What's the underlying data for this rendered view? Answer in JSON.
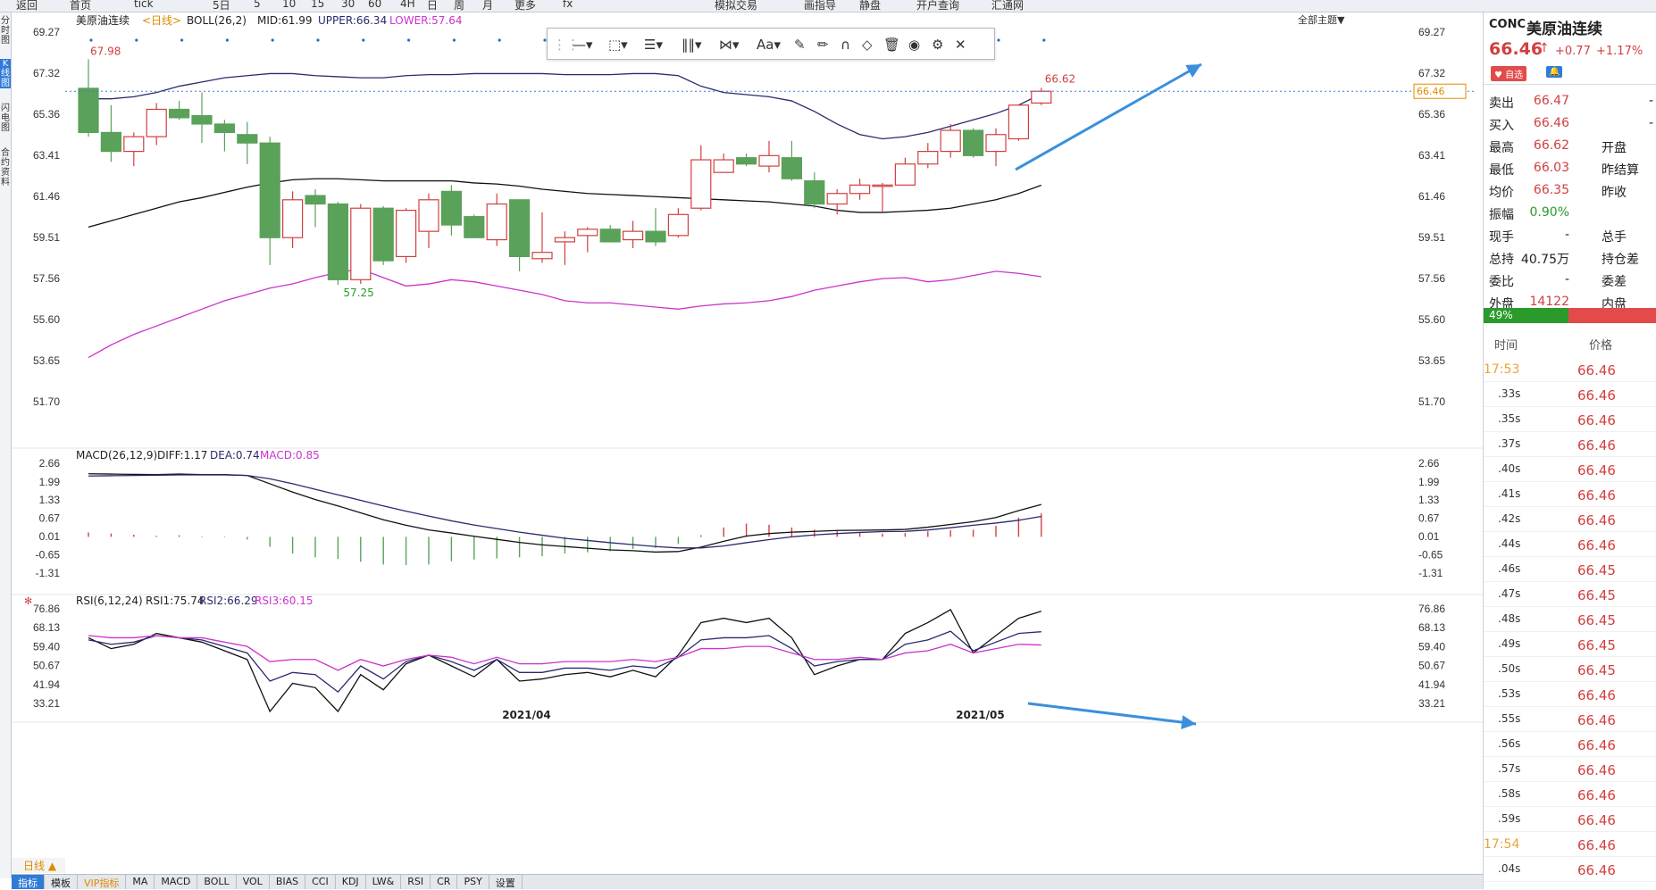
{
  "toolbar": {
    "items": [
      "返回",
      "首页",
      "tick",
      "5日",
      "5",
      "10",
      "15",
      "30",
      "60",
      "4H",
      "日",
      "周",
      "月",
      "更多",
      "fx",
      "模拟交易",
      "画指导",
      "静盘",
      "开户查询",
      "汇通网"
    ]
  },
  "left_tabs": [
    "分时图",
    "K线图",
    "闪电图",
    "合约资料"
  ],
  "chart": {
    "symbol": "美原油连续",
    "period": "<日线>",
    "boll": {
      "label": "BOLL(26,2)",
      "mid": "MID:61.99",
      "upper": "UPPER:66.34",
      "lower": "LOWER:57.64"
    },
    "main_axis": [
      "69.27",
      "67.32",
      "65.36",
      "63.41",
      "61.46",
      "59.51",
      "57.56",
      "55.60",
      "53.65",
      "51.70"
    ],
    "high_label": "67.98",
    "low_label": "57.25",
    "last_high_label": "66.62",
    "price_tag": "66.46",
    "main_theme": "全部主题▼",
    "macd": {
      "label": "MACD(26,12,9)",
      "diff": "DIFF:1.17",
      "dea": "DEA:0.74",
      "macd": "MACD:0.85",
      "axis": [
        "2.66",
        "1.99",
        "1.33",
        "0.67",
        "0.01",
        "-0.65",
        "-1.31"
      ]
    },
    "rsi": {
      "label": "RSI(6,12,24)",
      "rsi1": "RSI1:75.74",
      "rsi2": "RSI2:66.29",
      "rsi3": "RSI3:60.15",
      "axis": [
        "76.86",
        "68.13",
        "59.40",
        "50.67",
        "41.94",
        "33.21"
      ]
    },
    "x_labels": [
      "2021/04",
      "2021/05"
    ],
    "colors": {
      "up": "#d23f3f",
      "down": "#5aa15a",
      "upper": "#2a2a6e",
      "mid": "#111111",
      "lower": "#cc33cc",
      "arrow": "#3c8fdc"
    }
  },
  "chart_data": [
    {
      "type": "candlestick",
      "title": "美原油连续 日线 BOLL(26,2)",
      "ylim": [
        51.7,
        69.27
      ],
      "ohlc": [
        [
          66.6,
          67.98,
          64.3,
          64.5
        ],
        [
          64.5,
          65.8,
          63.1,
          63.6
        ],
        [
          63.6,
          64.5,
          62.9,
          64.3
        ],
        [
          64.3,
          65.9,
          63.9,
          65.6
        ],
        [
          65.6,
          66.0,
          65.1,
          65.2
        ],
        [
          65.3,
          66.4,
          64.0,
          64.9
        ],
        [
          64.9,
          65.1,
          63.6,
          64.5
        ],
        [
          64.4,
          65.0,
          63.0,
          64.0
        ],
        [
          64.0,
          64.3,
          58.2,
          59.5
        ],
        [
          59.5,
          61.7,
          59.0,
          61.3
        ],
        [
          61.5,
          61.8,
          60.0,
          61.1
        ],
        [
          61.1,
          61.2,
          57.25,
          57.5
        ],
        [
          57.5,
          61.1,
          57.3,
          60.9
        ],
        [
          60.9,
          61.0,
          58.2,
          58.4
        ],
        [
          58.6,
          60.9,
          58.3,
          60.8
        ],
        [
          59.8,
          61.6,
          59.0,
          61.3
        ],
        [
          61.7,
          62.0,
          59.6,
          60.1
        ],
        [
          60.5,
          60.6,
          59.5,
          59.5
        ],
        [
          59.4,
          61.6,
          59.1,
          61.1
        ],
        [
          61.3,
          61.3,
          57.9,
          58.6
        ],
        [
          58.5,
          60.7,
          58.3,
          58.8
        ],
        [
          59.3,
          59.8,
          58.2,
          59.5
        ],
        [
          59.6,
          60.0,
          58.8,
          59.9
        ],
        [
          59.9,
          60.1,
          59.3,
          59.3
        ],
        [
          59.4,
          60.3,
          59.0,
          59.8
        ],
        [
          59.8,
          60.9,
          59.1,
          59.3
        ],
        [
          59.6,
          60.9,
          59.5,
          60.6
        ],
        [
          60.9,
          63.9,
          60.8,
          63.2
        ],
        [
          62.6,
          63.5,
          62.6,
          63.2
        ],
        [
          63.3,
          63.5,
          62.9,
          63.0
        ],
        [
          62.9,
          64.1,
          62.6,
          63.4
        ],
        [
          63.3,
          64.1,
          62.2,
          62.3
        ],
        [
          62.2,
          62.6,
          60.9,
          61.1
        ],
        [
          61.1,
          61.8,
          60.6,
          61.6
        ],
        [
          61.6,
          62.3,
          61.3,
          62.0
        ],
        [
          62.0,
          62.1,
          60.7,
          62.0
        ],
        [
          62.0,
          63.3,
          62.0,
          63.0
        ],
        [
          63.0,
          64.0,
          62.8,
          63.6
        ],
        [
          63.6,
          64.9,
          63.3,
          64.6
        ],
        [
          64.6,
          64.7,
          63.3,
          63.4
        ],
        [
          63.6,
          64.7,
          62.9,
          64.4
        ],
        [
          64.2,
          65.4,
          64.1,
          65.8
        ],
        [
          65.9,
          66.62,
          65.8,
          66.46
        ]
      ],
      "boll_upper": [
        66.1,
        66.1,
        66.2,
        66.4,
        66.7,
        66.9,
        67.1,
        67.2,
        67.3,
        67.3,
        67.2,
        67.15,
        67.1,
        67.1,
        67.2,
        67.25,
        67.25,
        67.3,
        67.3,
        67.3,
        67.3,
        67.25,
        67.25,
        67.25,
        67.3,
        67.3,
        67.2,
        66.7,
        66.4,
        66.3,
        66.2,
        66.0,
        65.5,
        64.9,
        64.4,
        64.2,
        64.3,
        64.5,
        64.8,
        65.1,
        65.4,
        65.8,
        66.34
      ],
      "boll_mid": [
        60.0,
        60.3,
        60.6,
        60.9,
        61.2,
        61.4,
        61.65,
        61.9,
        62.1,
        62.25,
        62.3,
        62.3,
        62.25,
        62.2,
        62.2,
        62.2,
        62.2,
        62.1,
        62.05,
        61.95,
        61.8,
        61.7,
        61.6,
        61.55,
        61.5,
        61.45,
        61.4,
        61.35,
        61.3,
        61.25,
        61.2,
        61.1,
        61.0,
        60.8,
        60.7,
        60.7,
        60.75,
        60.8,
        60.9,
        61.1,
        61.3,
        61.6,
        61.99
      ],
      "boll_lower": [
        53.8,
        54.4,
        54.9,
        55.3,
        55.7,
        56.1,
        56.5,
        56.8,
        57.1,
        57.3,
        57.6,
        57.85,
        58.0,
        57.6,
        57.2,
        57.3,
        57.5,
        57.4,
        57.2,
        57.0,
        56.8,
        56.5,
        56.4,
        56.4,
        56.3,
        56.2,
        56.1,
        56.25,
        56.35,
        56.4,
        56.5,
        56.7,
        57.0,
        57.2,
        57.4,
        57.55,
        57.6,
        57.4,
        57.5,
        57.7,
        57.9,
        57.8,
        57.64
      ]
    },
    {
      "type": "line",
      "title": "MACD(26,12,9)",
      "ylim": [
        -1.31,
        2.66
      ],
      "diff": [
        2.28,
        2.27,
        2.26,
        2.25,
        2.27,
        2.25,
        2.25,
        2.22,
        1.92,
        1.62,
        1.35,
        1.12,
        0.87,
        0.62,
        0.42,
        0.25,
        0.14,
        0.02,
        -0.09,
        -0.2,
        -0.29,
        -0.35,
        -0.41,
        -0.47,
        -0.5,
        -0.55,
        -0.53,
        -0.37,
        -0.16,
        0.03,
        0.12,
        0.17,
        0.2,
        0.23,
        0.24,
        0.25,
        0.27,
        0.35,
        0.45,
        0.55,
        0.7,
        0.95,
        1.17
      ],
      "dea": [
        2.2,
        2.21,
        2.22,
        2.23,
        2.24,
        2.24,
        2.24,
        2.22,
        2.1,
        1.92,
        1.72,
        1.52,
        1.32,
        1.12,
        0.93,
        0.75,
        0.58,
        0.43,
        0.3,
        0.17,
        0.06,
        -0.05,
        -0.13,
        -0.21,
        -0.28,
        -0.35,
        -0.4,
        -0.4,
        -0.33,
        -0.21,
        -0.1,
        -0.0,
        0.07,
        0.12,
        0.16,
        0.19,
        0.2,
        0.25,
        0.33,
        0.42,
        0.5,
        0.6,
        0.74
      ],
      "macd": [
        0.16,
        0.12,
        0.08,
        0.04,
        0.06,
        0.02,
        0.02,
        -0.1,
        -0.36,
        -0.6,
        -0.74,
        -0.8,
        -0.9,
        -1.0,
        -1.02,
        -1.0,
        -0.88,
        -0.82,
        -0.78,
        -0.74,
        -0.7,
        -0.6,
        -0.56,
        -0.52,
        -0.44,
        -0.4,
        -0.26,
        0.06,
        0.34,
        0.48,
        0.44,
        0.34,
        0.26,
        0.22,
        0.16,
        0.12,
        0.14,
        0.2,
        0.24,
        0.26,
        0.4,
        0.7,
        0.85
      ]
    },
    {
      "type": "line",
      "title": "RSI(6,12,24)",
      "ylim": [
        33.21,
        76.86
      ],
      "rsi1": [
        63.5,
        58.5,
        60.5,
        65.5,
        63.5,
        61.5,
        57.5,
        53.5,
        29.5,
        42.5,
        40.5,
        29.5,
        46.5,
        39.5,
        51.5,
        55.5,
        50.5,
        45.5,
        53.5,
        43.5,
        44.5,
        46.5,
        47.5,
        45.5,
        48.5,
        45.5,
        55.5,
        70.5,
        72.5,
        70.5,
        72.5,
        63.5,
        46.5,
        50.5,
        53.5,
        53.5,
        65.5,
        70.5,
        76.5,
        56.5,
        64.5,
        72.5,
        75.74
      ],
      "rsi2": [
        62.5,
        60.5,
        61.5,
        64.5,
        63.5,
        62.5,
        59.5,
        56.5,
        43.5,
        47.5,
        46.5,
        38.5,
        50.5,
        44.5,
        52.5,
        55.5,
        52.5,
        48.5,
        53.5,
        47.5,
        47.5,
        49.5,
        49.5,
        48.5,
        50.5,
        49.5,
        54.5,
        62.5,
        63.5,
        63.5,
        64.5,
        58.5,
        50.5,
        52.5,
        53.5,
        53.5,
        60.5,
        62.5,
        66.5,
        57.5,
        61.5,
        65.5,
        66.29
      ],
      "rsi3": [
        64.5,
        63.5,
        63.5,
        64.5,
        63.5,
        63.5,
        61.5,
        59.5,
        52.5,
        53.5,
        53.5,
        48.5,
        53.5,
        50.5,
        53.5,
        55.5,
        54.5,
        51.5,
        54.5,
        51.5,
        51.5,
        52.5,
        52.5,
        52.5,
        53.5,
        52.5,
        54.5,
        58.5,
        58.5,
        59.5,
        59.5,
        56.5,
        53.5,
        53.5,
        54.5,
        53.5,
        56.5,
        57.5,
        60.5,
        56.5,
        58.5,
        60.5,
        60.15
      ]
    }
  ],
  "panel": {
    "code": "CONC",
    "name": "美原油连续",
    "price": "66.46",
    "arrow": "↑",
    "change": "+0.77",
    "pct": "+1.17%",
    "btn_fav": "♥ 自选",
    "btn_bell": "🔔",
    "rows": [
      {
        "l": "卖出",
        "v": "66.47",
        "r": "-",
        "vc": "#d23f3f"
      },
      {
        "l": "买入",
        "v": "66.46",
        "r": "-",
        "vc": "#d23f3f"
      },
      {
        "l": "最高",
        "v": "66.62",
        "r": "开盘",
        "vc": "#d23f3f"
      },
      {
        "l": "最低",
        "v": "66.03",
        "r": "昨结算",
        "vc": "#d23f3f"
      },
      {
        "l": "均价",
        "v": "66.35",
        "r": "昨收",
        "vc": "#d23f3f"
      },
      {
        "l": "振幅",
        "v": "0.90%",
        "r": "",
        "vc": "#2a9b2a"
      },
      {
        "l": "现手",
        "v": "-",
        "r": "总手",
        "vc": "#222"
      },
      {
        "l": "总持",
        "v": "40.75万",
        "r": "持仓差",
        "vc": "#222"
      },
      {
        "l": "委比",
        "v": "-",
        "r": "委差",
        "vc": "#222"
      },
      {
        "l": "外盘",
        "v": "14122",
        "r": "内盘",
        "vc": "#d23f3f"
      }
    ],
    "bar_pct": "49%",
    "ticks_header": {
      "time": "时间",
      "price": "价格"
    },
    "ticks": [
      [
        "17:53",
        "66.46"
      ],
      [
        ".33s",
        "66.46"
      ],
      [
        ".35s",
        "66.46"
      ],
      [
        ".37s",
        "66.46"
      ],
      [
        ".40s",
        "66.46"
      ],
      [
        ".41s",
        "66.46"
      ],
      [
        ".42s",
        "66.46"
      ],
      [
        ".44s",
        "66.46"
      ],
      [
        ".46s",
        "66.45"
      ],
      [
        ".47s",
        "66.45"
      ],
      [
        ".48s",
        "66.45"
      ],
      [
        ".49s",
        "66.45"
      ],
      [
        ".50s",
        "66.45"
      ],
      [
        ".53s",
        "66.46"
      ],
      [
        ".55s",
        "66.46"
      ],
      [
        ".56s",
        "66.46"
      ],
      [
        ".57s",
        "66.46"
      ],
      [
        ".58s",
        "66.46"
      ],
      [
        ".59s",
        "66.46"
      ],
      [
        "17:54",
        "66.46"
      ],
      [
        ".04s",
        "66.46"
      ]
    ]
  },
  "bottom_tabs": [
    "指标",
    "模板",
    "VIP指标",
    "MA",
    "MACD",
    "BOLL",
    "VOL",
    "BIAS",
    "CCI",
    "KDJ",
    "LW&",
    "RSI",
    "CR",
    "PSY",
    "设置"
  ],
  "day_line": "日线 ▲"
}
